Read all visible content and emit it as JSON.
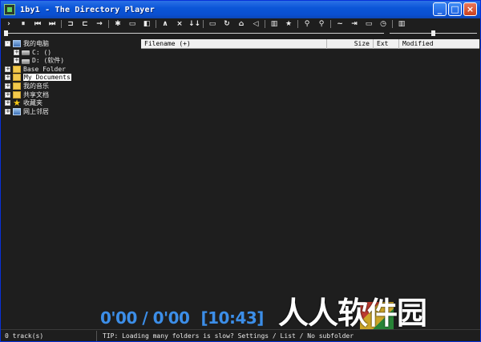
{
  "window": {
    "title": "1by1 - The Directory Player",
    "buttons": {
      "minimize": "_",
      "maximize": "□",
      "close": "×"
    }
  },
  "toolbar": {
    "groups": [
      [
        "›",
        "⏸",
        "⏮",
        "⏭"
      ],
      [
        "⊐",
        "⊏",
        "→"
      ],
      [
        "✱",
        "▭",
        "◧"
      ],
      [
        "∧",
        "×",
        "↓↓"
      ],
      [
        "▭",
        "↻",
        "⌂",
        "◁"
      ],
      [
        "▥",
        "★"
      ],
      [
        "⚲",
        "⚲"
      ],
      [
        "~",
        "⇥",
        "▭",
        "◷"
      ],
      [
        "▥"
      ]
    ],
    "icon_names": [
      "play-icon",
      "pause-icon",
      "previous-icon",
      "next-icon",
      "folder-back-icon",
      "folder-forward-icon",
      "arrow-right-icon",
      "settings-icon",
      "window-icon",
      "panel-icon",
      "up-icon",
      "remove-icon",
      "sort-down-icon",
      "playlist-icon",
      "refresh-icon",
      "home-icon",
      "volume-icon",
      "library-icon",
      "favorite-icon",
      "search-icon",
      "find-icon",
      "wave-icon",
      "enqueue-icon",
      "display-icon",
      "timer-icon",
      "columns-icon"
    ]
  },
  "player": {
    "seek_fraction": 0.0,
    "volume_fraction": 0.5
  },
  "tree": {
    "items": [
      {
        "label": "我的电脑",
        "icon": "computer-icon",
        "expander": "-"
      },
      {
        "label": "C: ()",
        "icon": "drive-icon",
        "expander": "+"
      },
      {
        "label": "D: (软件)",
        "icon": "drive-icon",
        "expander": "+"
      },
      {
        "label": "Base Folder",
        "icon": "folder-icon",
        "expander": "+"
      },
      {
        "label": "My Documents",
        "icon": "documents-folder-icon",
        "expander": "+",
        "selected": true
      },
      {
        "label": "我的音乐",
        "icon": "music-folder-icon",
        "expander": "+"
      },
      {
        "label": "共享文档",
        "icon": "folder-icon",
        "expander": "+"
      },
      {
        "label": "收藏夹",
        "icon": "favorites-star-icon",
        "expander": "+"
      },
      {
        "label": "网上邻居",
        "icon": "network-icon",
        "expander": "+"
      }
    ]
  },
  "filelist": {
    "columns": {
      "name": "Filename (+)",
      "size": "Size",
      "ext": "Ext",
      "modified": "Modified"
    }
  },
  "time": {
    "position": "0'00 / 0'00",
    "clock": "[10:43]"
  },
  "watermark": {
    "text": "人人软件园"
  },
  "status": {
    "tracks": "0 track(s)",
    "tip": "TIP: Loading many folders is slow? Settings / List / No subfolder"
  }
}
